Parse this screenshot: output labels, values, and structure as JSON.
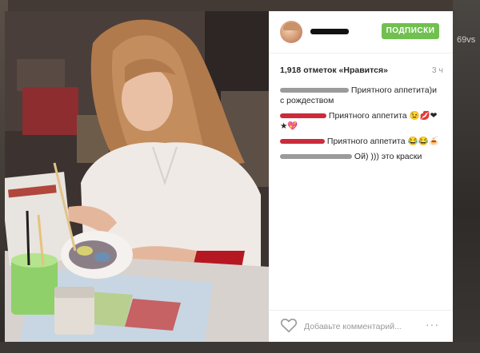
{
  "post": {
    "likes_text": "1,918 отметок «Нравится»",
    "time": "3 ч",
    "follow_label": "ПОДПИСКИ",
    "comment_placeholder": "Добавьте комментарий...",
    "more_label": "···"
  },
  "comments": [
    {
      "text_line1": "Приятного аппетита)и",
      "text_line2": "с рождеством",
      "redaction_color": "gray"
    },
    {
      "text": "Приятного аппетита 😉💋❤",
      "extra": "★💖",
      "redaction_color": "red"
    },
    {
      "text": "Приятного аппетита 😂😂🍝",
      "redaction_color": "red"
    },
    {
      "text": "Ой) ))) это краски",
      "redaction_color": "gray"
    }
  ],
  "background": {
    "right_edge_text": "69vs"
  },
  "colors": {
    "follow_button": "#70c050",
    "redaction_gray": "#9b9b9b",
    "redaction_red": "#cc2b3b"
  },
  "icons": {
    "like": "heart-outline-icon",
    "more": "ellipsis-icon"
  }
}
